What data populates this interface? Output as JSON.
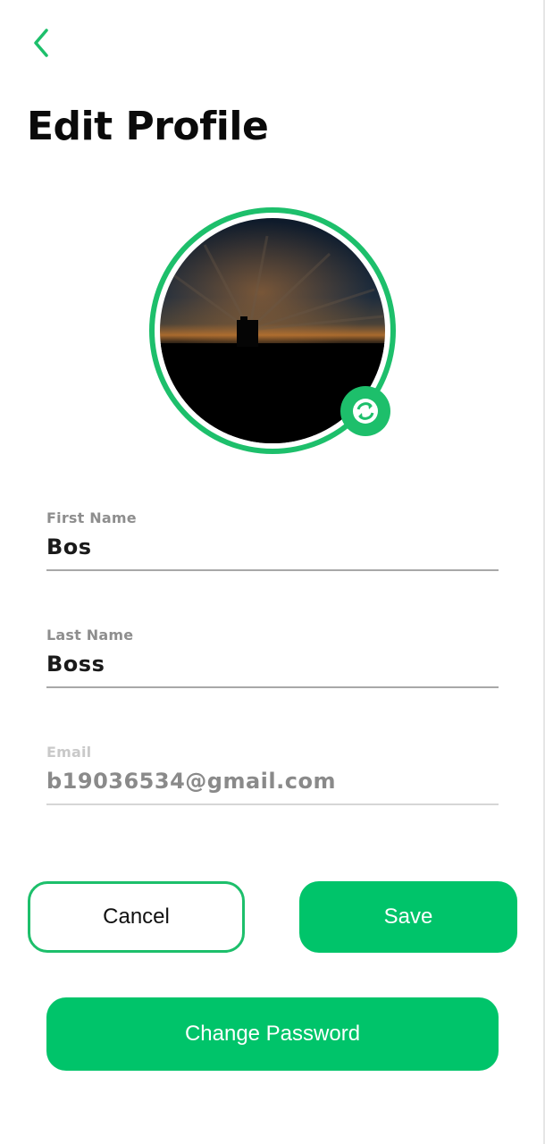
{
  "header": {
    "back_icon": "chevron-left-icon",
    "title": "Edit Profile"
  },
  "avatar": {
    "image": "sunset silhouette photo",
    "change_icon": "swap-photo-icon",
    "ring_color": "#1dbf6b"
  },
  "form": {
    "first_name": {
      "label": "First Name",
      "value": "Bos"
    },
    "last_name": {
      "label": "Last Name",
      "value": "Boss"
    },
    "email": {
      "label": "Email",
      "value": "b19036534@gmail.com",
      "disabled": true
    }
  },
  "actions": {
    "cancel_label": "Cancel",
    "save_label": "Save",
    "change_password_label": "Change Password"
  },
  "colors": {
    "accent": "#00c46a",
    "text": "#0a0a0a",
    "muted": "#8e8e8e"
  }
}
